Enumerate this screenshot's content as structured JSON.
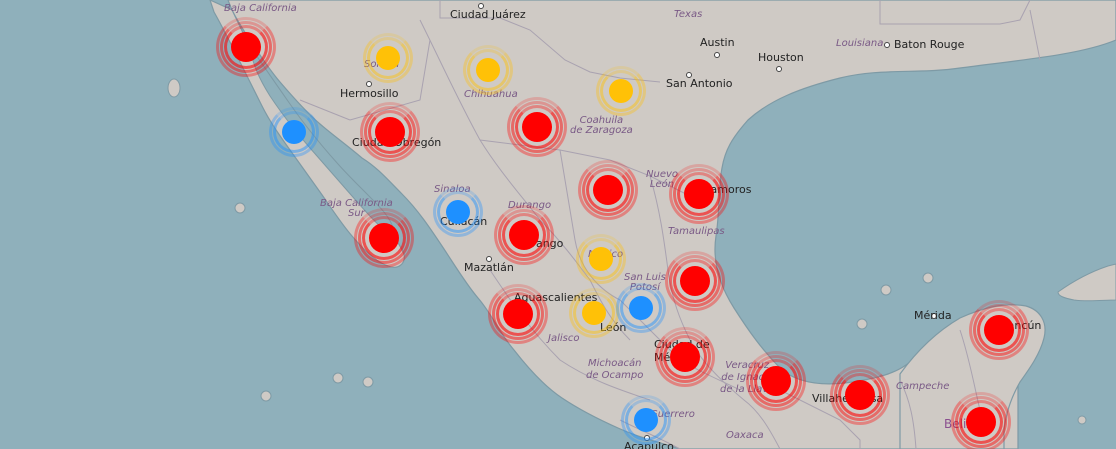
{
  "map": {
    "colors": {
      "water": "#8fb0bb",
      "land": "#cfcac5",
      "border": "#a9a2b0",
      "coast": "#7e9aa5"
    },
    "labels": {
      "baja_california": "Baja California",
      "ciudad_juarez": "Ciudad Juárez",
      "texas": "Texas",
      "austin": "Austin",
      "houston": "Houston",
      "louisiana": "Louisiana",
      "baton_rouge": "Baton Rouge",
      "sonora": "Sonora",
      "hermosillo": "Hermosillo",
      "chihuahua": "Chihuahua",
      "san_antonio": "San Antonio",
      "coahuila": "Coahuila\nde Zaragoza",
      "ciudad_obregon": "Ciudad Obregón",
      "sinaloa": "Sinaloa",
      "culiacan": "Culiacán",
      "baja_california_sur": "Baja California\nSur",
      "durango_state": "Durango",
      "durango_city": "Durango",
      "nuevo_leon": "Nuevo\nLeón",
      "matamoros": "Matamoros",
      "tamaulipas": "Tamaulipas",
      "mazatlan": "Mazatlán",
      "mexico": "México",
      "san_luis_potosi": "San Luis\nPotosí",
      "aguascalientes": "Aguascalientes",
      "leon": "León",
      "jalisco": "Jalisco",
      "michoacan": "Michoacán\nde Ocampo",
      "ciudad_de_mexico": "Ciudad de\nMéxico",
      "veracruz": "Veracruz\nde Ignacio\nde la Llave",
      "villahermosa": "Villahermosa",
      "campeche": "Campeche",
      "merida": "Mérida",
      "cancun": "Cancún",
      "guerrero": "Guerrero",
      "oaxaca": "Oaxaca",
      "acapulco": "Acapulco",
      "belize": "Belize"
    },
    "markers": [
      {
        "id": "tijuana",
        "status": "red",
        "color": "#ff0000"
      },
      {
        "id": "sonora-north",
        "status": "yellow",
        "color": "#ffc107"
      },
      {
        "id": "chihuahua-north",
        "status": "yellow",
        "color": "#ffc107"
      },
      {
        "id": "coahuila-north",
        "status": "yellow",
        "color": "#ffc107"
      },
      {
        "id": "baja-mid",
        "status": "blue",
        "color": "#1e90ff"
      },
      {
        "id": "ciudad-obregon",
        "status": "red",
        "color": "#ff0000"
      },
      {
        "id": "chihuahua-south",
        "status": "red",
        "color": "#ff0000"
      },
      {
        "id": "monterrey",
        "status": "red",
        "color": "#ff0000"
      },
      {
        "id": "matamoros",
        "status": "red",
        "color": "#ff0000"
      },
      {
        "id": "culiacan",
        "status": "blue",
        "color": "#1e90ff"
      },
      {
        "id": "la-paz",
        "status": "red",
        "color": "#ff0000"
      },
      {
        "id": "durango",
        "status": "red",
        "color": "#ff0000"
      },
      {
        "id": "zacatecas",
        "status": "yellow",
        "color": "#ffc107"
      },
      {
        "id": "tampico",
        "status": "red",
        "color": "#ff0000"
      },
      {
        "id": "guadalajara",
        "status": "red",
        "color": "#ff0000"
      },
      {
        "id": "leon",
        "status": "yellow",
        "color": "#ffc107"
      },
      {
        "id": "san-luis-potosi",
        "status": "blue",
        "color": "#1e90ff"
      },
      {
        "id": "ciudad-de-mexico",
        "status": "red",
        "color": "#ff0000"
      },
      {
        "id": "veracruz",
        "status": "red",
        "color": "#ff0000"
      },
      {
        "id": "villahermosa",
        "status": "red",
        "color": "#ff0000"
      },
      {
        "id": "cancun",
        "status": "red",
        "color": "#ff0000"
      },
      {
        "id": "acapulco",
        "status": "blue",
        "color": "#1e90ff"
      },
      {
        "id": "belize",
        "status": "red",
        "color": "#ff0000"
      }
    ]
  }
}
